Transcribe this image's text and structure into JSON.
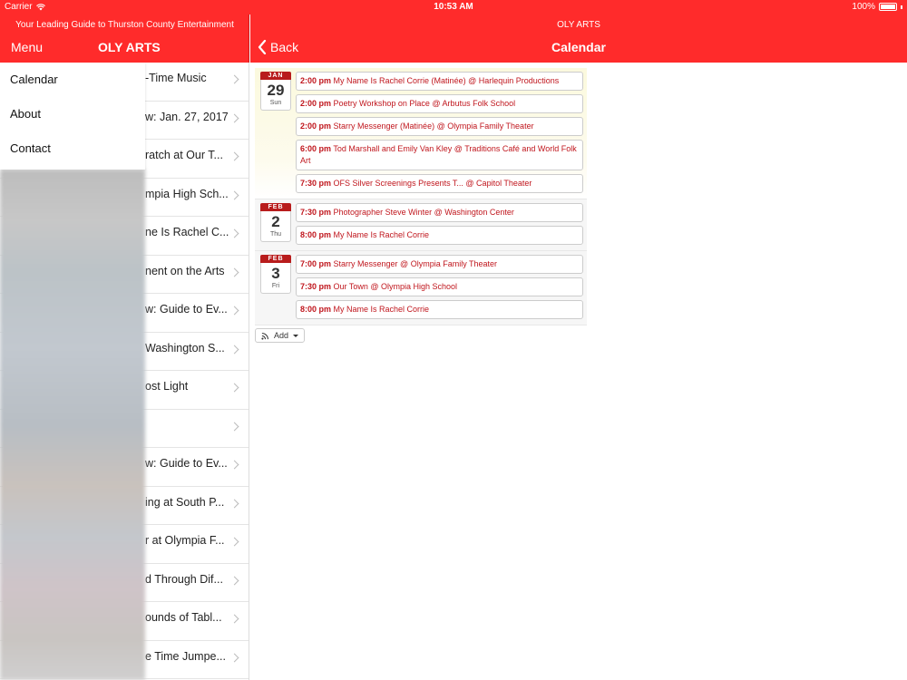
{
  "status": {
    "carrier": "Carrier",
    "time": "10:53 AM",
    "battery": "100%"
  },
  "left": {
    "tagline": "Your Leading Guide to Thurston County Entertainment",
    "menu_label": "Menu",
    "brand": "OLY ARTS",
    "menu_items": [
      "Calendar",
      "About",
      "Contact"
    ],
    "list_items": [
      "-Time Music",
      "w: Jan. 27, 2017",
      "ratch at Our T...",
      "mpia High Sch...",
      "ne Is Rachel C...",
      "nent on the Arts",
      "w: Guide to Ev...",
      "Washington S...",
      "ost Light",
      "",
      "w: Guide to Ev...",
      "ing at South P...",
      "r at Olympia F...",
      "d Through Dif...",
      "ounds of Tabl...",
      "e Time Jumpe..."
    ]
  },
  "right": {
    "subtitle": "OLY ARTS",
    "back_label": "Back",
    "title": "Calendar"
  },
  "calendar": {
    "days": [
      {
        "month": "JAN",
        "day": "29",
        "weekday": "Sun",
        "events": [
          {
            "time": "2:00 pm",
            "title": "My Name Is Rachel Corrie (Matinée) @ Harlequin Productions"
          },
          {
            "time": "2:00 pm",
            "title": "Poetry Workshop on Place @ Arbutus Folk School"
          },
          {
            "time": "2:00 pm",
            "title": "Starry Messenger (Matinée) @ Olympia Family Theater"
          },
          {
            "time": "6:00 pm",
            "title": "Tod Marshall and Emily Van Kley @ Traditions Café and World Folk Art"
          },
          {
            "time": "7:30 pm",
            "title": "OFS Silver Screenings Presents T... @ Capitol Theater"
          }
        ]
      },
      {
        "month": "FEB",
        "day": "2",
        "weekday": "Thu",
        "events": [
          {
            "time": "7:30 pm",
            "title": "Photographer Steve Winter @ Washington Center"
          },
          {
            "time": "8:00 pm",
            "title": "My Name Is Rachel Corrie"
          }
        ]
      },
      {
        "month": "FEB",
        "day": "3",
        "weekday": "Fri",
        "events": [
          {
            "time": "7:00 pm",
            "title": "Starry Messenger @ Olympia Family Theater"
          },
          {
            "time": "7:30 pm",
            "title": "Our Town @ Olympia High School"
          },
          {
            "time": "8:00 pm",
            "title": "My Name Is Rachel Corrie"
          }
        ]
      }
    ],
    "add_label": "Add"
  },
  "colors": {
    "header_red": "#ff2b2b",
    "event_red": "#c0161d"
  }
}
